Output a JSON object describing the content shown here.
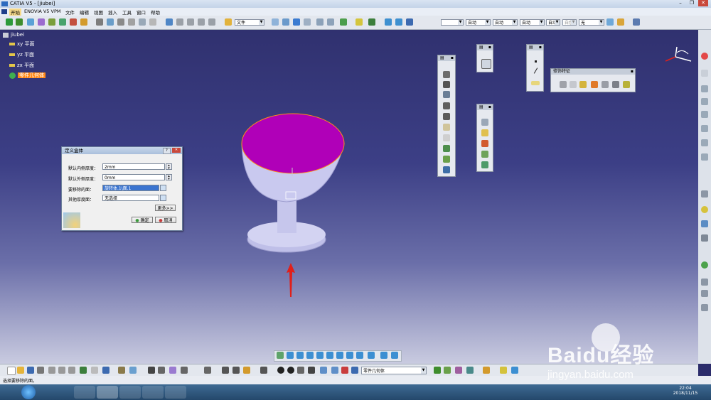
{
  "window": {
    "title": "CATIA V5 - [jiubei]",
    "minimize": "–",
    "restore": "❐",
    "close": "✕"
  },
  "menu": [
    "开始",
    "ENOVIA V5 VPM",
    "文件",
    "编辑",
    "视图",
    "插入",
    "工具",
    "窗口",
    "帮助"
  ],
  "toolbar_top": {
    "combo_file": "文件",
    "combo_line": "",
    "combo_auto1": "自动",
    "combo_auto2": "自动",
    "combo_auto3": "自动",
    "combo_white": "白色",
    "combo_layer": "无"
  },
  "tree": {
    "root": "jiubei",
    "items": [
      "xy 平面",
      "yz 平面",
      "zx 平面",
      "零件几何体"
    ]
  },
  "palettes": {
    "modify_features_title": "修饰特征"
  },
  "dialog": {
    "title": "定义盒体",
    "inner_thickness_label": "默认内侧厚度：",
    "inner_thickness_value": "2mm",
    "outer_thickness_label": "默认外侧厚度：",
    "outer_thickness_value": "0mm",
    "faces_to_remove_label": "要移除的面：",
    "faces_to_remove_value": "旋转体.1\\面.1",
    "other_thickness_label": "其他厚度面：",
    "other_thickness_value": "无选择",
    "more_button": "更多>>",
    "ok_button": "确定",
    "cancel_button": "取消"
  },
  "bottom_toolbar": {
    "body_combo": "零件几何体"
  },
  "status": {
    "prompt": "选择要移除的面。"
  },
  "taskbar": {
    "time": "22:04",
    "date": "2018/11/15"
  },
  "watermark": {
    "brand": "Baidu经验",
    "url": "jingyan.baidu.com"
  },
  "colors": {
    "cup_top": "#b000b8",
    "cup_body": "#c8c8ee",
    "highlight": "#ff8a1a",
    "arrow": "#e0201a"
  }
}
